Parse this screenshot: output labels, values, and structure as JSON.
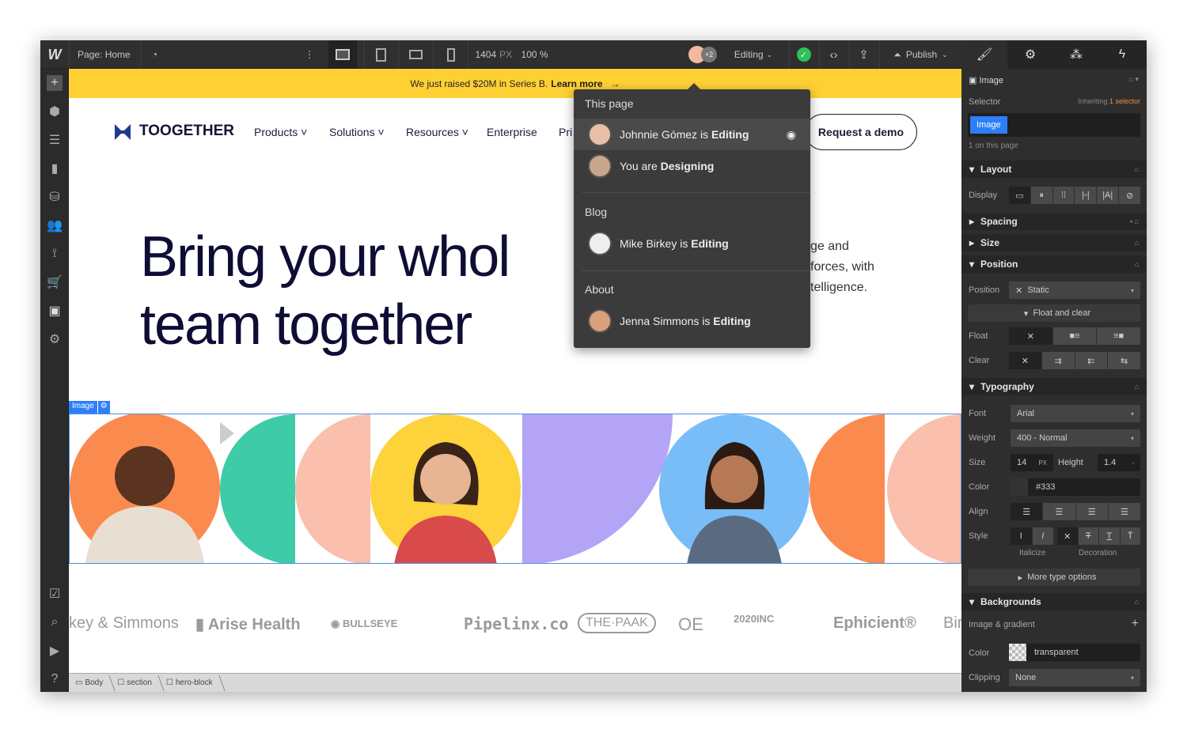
{
  "topbar": {
    "logo": "W",
    "page": "Page: Home",
    "width_value": "1404",
    "width_unit": "PX",
    "zoom": "100 %",
    "collab_count": "+2",
    "mode": "Editing",
    "publish": "Publish"
  },
  "banner": {
    "text": "We just raised $20M in Series B.",
    "link": "Learn more",
    "arrow": "→"
  },
  "site": {
    "brand": "TOOGETHER",
    "nav": [
      "Products",
      "Solutions",
      "Resources",
      "Enterprise",
      "Pri"
    ],
    "cta": "Request a demo",
    "hero": [
      "Bring your whol",
      "team together"
    ],
    "para": [
      "ge and",
      "forces, with",
      "telligence."
    ],
    "image_tag": "Image",
    "logos": [
      "key & Simmons",
      "Arise Health",
      "BULLSEYE",
      "Pipelinx.co",
      "THE·PAAK",
      "OE",
      "2020INC",
      "Ephicient®",
      "Bir"
    ]
  },
  "popover": {
    "sections": [
      {
        "title": "This page",
        "items": [
          {
            "name": "Johnnie Gómez is",
            "status": "Editing"
          },
          {
            "name": "You are",
            "status": "Designing"
          }
        ]
      },
      {
        "title": "Blog",
        "items": [
          {
            "name": "Mike Birkey is",
            "status": "Editing"
          }
        ]
      },
      {
        "title": "About",
        "items": [
          {
            "name": "Jenna Simmons is",
            "status": "Editing"
          }
        ]
      }
    ]
  },
  "breadcrumb": [
    "Body",
    "section",
    "hero-block"
  ],
  "panel": {
    "element": "Image",
    "selector_label": "Selector",
    "inheriting": "Inheriting",
    "inheriting_count": "1 selector",
    "selector_chip": "Image",
    "on_page": "1 on this page",
    "layout": "Layout",
    "display": "Display",
    "spacing": "Spacing",
    "size": "Size",
    "position": "Position",
    "position_label": "Position",
    "position_value": "Static",
    "float_clear": "Float and clear",
    "float": "Float",
    "clear": "Clear",
    "typography": "Typography",
    "font_label": "Font",
    "font": "Arial",
    "weight_label": "Weight",
    "weight": "400 - Normal",
    "size_label": "Size",
    "size_value": "14",
    "size_unit": "PX",
    "height_label": "Height",
    "height_value": "1.4",
    "height_unit": "-",
    "color_label": "Color",
    "color_value": "#333",
    "align_label": "Align",
    "style_label": "Style",
    "italicize": "Italicize",
    "decoration": "Decoration",
    "more_type": "More type options",
    "backgrounds": "Backgrounds",
    "image_gradient": "Image & gradient",
    "bg_color_label": "Color",
    "bg_color": "transparent",
    "clipping_label": "Clipping",
    "clipping": "None"
  },
  "colors": {
    "banner": "#ffd034",
    "accent": "#2d7ff9",
    "brand": "#1f3a8a",
    "selection": "#4a90e2"
  }
}
